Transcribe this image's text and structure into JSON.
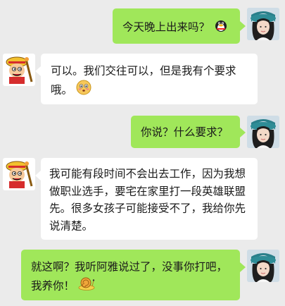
{
  "conversation": {
    "messages": [
      {
        "sender": "self",
        "avatar": "girl-avatar",
        "text": "今天晚上出来吗？",
        "emoji": "penguin-icon"
      },
      {
        "sender": "other",
        "avatar": "pirate-boy-avatar",
        "text": "可以。我们交往可以，但是我有个要求哦。",
        "emoji": "embarrassed-face-icon"
      },
      {
        "sender": "self",
        "avatar": "girl-avatar",
        "text": "你说？什么要求？",
        "emoji": ""
      },
      {
        "sender": "other",
        "avatar": "pirate-boy-avatar",
        "text": "我可能有段时间不会出去工作，因为我想做职业选手，要宅在家里打一段英雄联盟先。很多女孩子可能接受不了，我给你先说清楚。",
        "emoji": ""
      },
      {
        "sender": "self",
        "avatar": "girl-avatar",
        "text": "就这啊？我听阿雅说过了，没事你打吧，我养你！",
        "emoji": "snail-icon"
      }
    ]
  },
  "colors": {
    "background": "#ebebeb",
    "self_bubble": "#a0e75a",
    "other_bubble": "#ffffff"
  }
}
